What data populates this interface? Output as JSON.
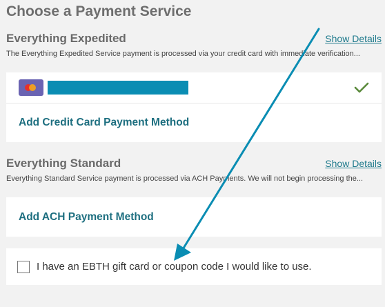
{
  "page": {
    "title": "Choose a Payment Service"
  },
  "expedited": {
    "title": "Everything Expedited",
    "show_details": "Show Details",
    "description": "The Everything Expedited Service payment is processed via your credit card with immediate verification...",
    "saved_card": {
      "selected": true
    },
    "add_label": "Add Credit Card Payment Method"
  },
  "standard": {
    "title": "Everything Standard",
    "show_details": "Show Details",
    "description": "Everything Standard Service payment is processed via ACH Payments. We will not begin processing the...",
    "add_label": "Add ACH Payment Method"
  },
  "coupon": {
    "label": "I have an EBTH gift card or coupon code I would like to use.",
    "checked": false
  },
  "colors": {
    "accent": "#1e6f80",
    "link": "#1e7a8c",
    "check": "#5b8a3c",
    "annotation_arrow": "#0a8db3",
    "card_badge": "#6a63b2"
  },
  "icons": {
    "card_brand": "mastercard-icon",
    "selected": "checkmark-icon",
    "annotation": "arrow-annotation-icon"
  }
}
